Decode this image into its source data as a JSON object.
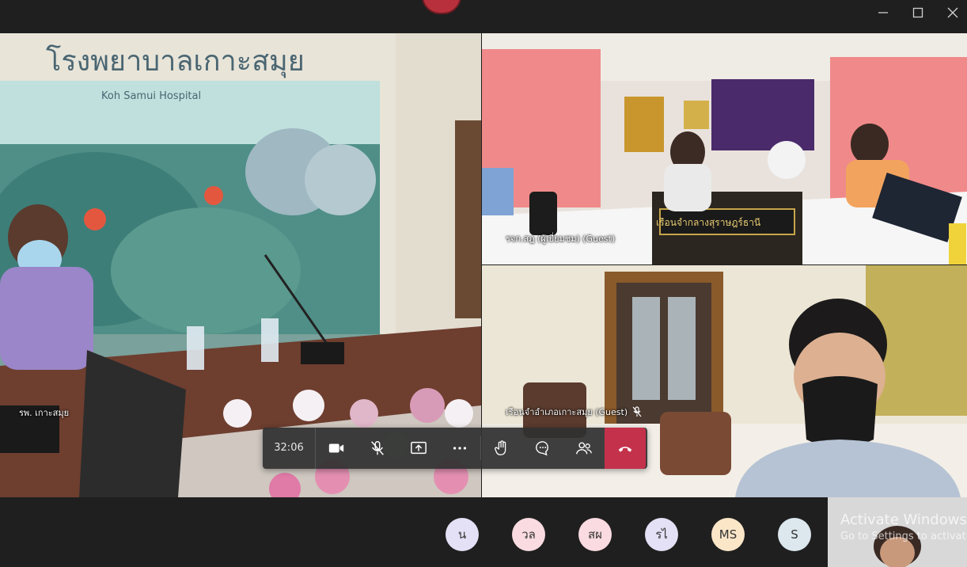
{
  "window": {
    "minimize_icon": "minimize-icon",
    "maximize_icon": "maximize-icon",
    "close_icon": "close-icon"
  },
  "tiles": {
    "main": {
      "name": "รพ. เกาะสมุย",
      "wall_text": "โรงพยาบาลเกาะสมุย",
      "wall_subtext": "Koh Samui Hospital"
    },
    "top_right": {
      "name": "รจก.สฎ (ผู้เยี่ยมชม) (Guest)",
      "sign_text": "เรือนจำกลางสุราษฎร์ธานี"
    },
    "bottom_right": {
      "name": "เรือนจำอำเภอเกาะสมุย (Guest)",
      "muted_icon": "mic-off-icon"
    }
  },
  "controls": {
    "timer": "32:06",
    "camera_icon": "video-camera-icon",
    "mic_icon": "mic-off-icon",
    "share_icon": "share-screen-icon",
    "more_icon": "more-actions-icon",
    "raise_hand_icon": "raise-hand-icon",
    "chat_icon": "chat-icon",
    "participants_icon": "participants-icon",
    "hangup_icon": "hang-up-icon"
  },
  "participants": [
    {
      "initials": "น",
      "color": "#e4e0f5"
    },
    {
      "initials": "วล",
      "color": "#f9dbe1"
    },
    {
      "initials": "สผ",
      "color": "#f9dbe1"
    },
    {
      "initials": "รไ",
      "color": "#e4e0f5"
    },
    {
      "initials": "MS",
      "color": "#fbe6c8"
    },
    {
      "initials": "S",
      "color": "#dce8ee"
    }
  ],
  "watermark": {
    "title": "Activate Windows",
    "subtitle": "Go to Settings to activat"
  },
  "colors": {
    "hangup": "#c4314b",
    "bar": "#303030",
    "background": "#1f1f1f"
  }
}
